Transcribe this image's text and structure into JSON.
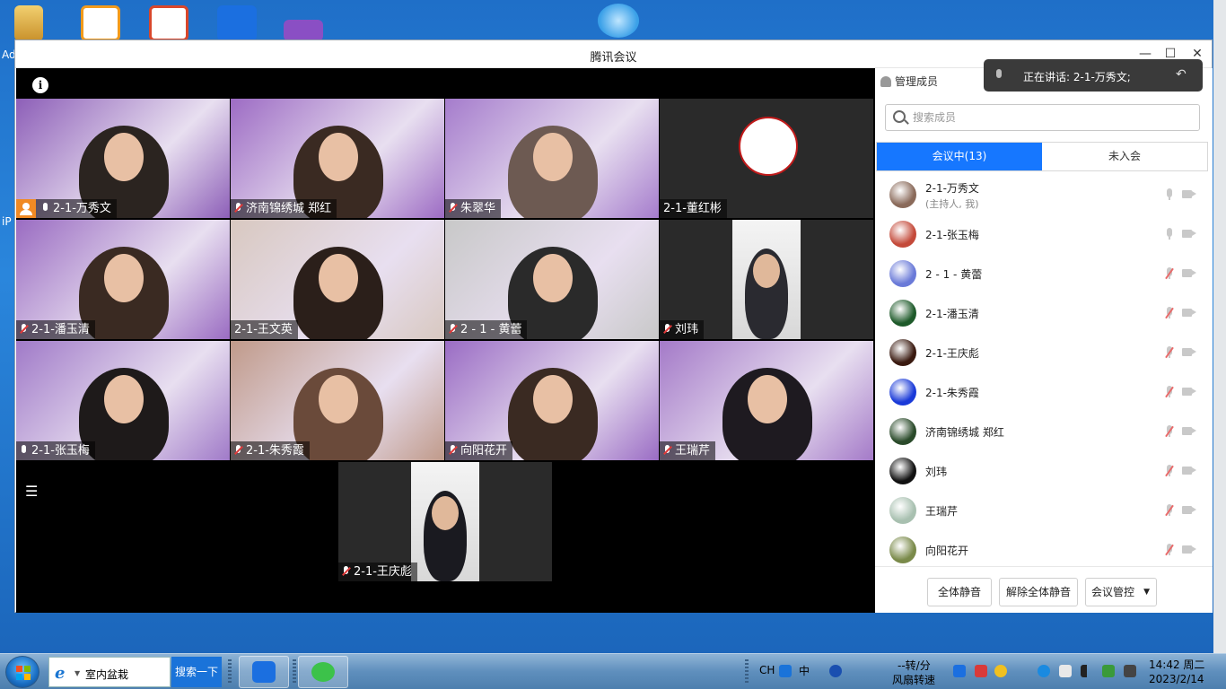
{
  "desktop": {
    "left_texts": [
      "Ad",
      "iP"
    ],
    "icons": [
      {
        "name": "folder-user-icon",
        "color": "#e0b040"
      },
      {
        "name": "wps-presentation-icon",
        "color": "#f29a1b"
      },
      {
        "name": "powerpoint-icon",
        "color": "#d9472b"
      },
      {
        "name": "tencent-meeting-icon",
        "color": "#1b6fe0"
      },
      {
        "name": "purple-file-icon",
        "color": "#7a3fb0"
      }
    ]
  },
  "window": {
    "title": "腾讯会议",
    "minimize": "—",
    "maximize": "☐",
    "close": "✕"
  },
  "video": {
    "tiles": [
      {
        "name": "2-1-万秀文",
        "host": true,
        "muted": false,
        "active": true,
        "bg": "#8d5fb8",
        "person": "#2b2420"
      },
      {
        "name": "济南锦绣城  郑红",
        "host": false,
        "muted": true,
        "bg": "#9d6cc4",
        "person": "#3a2a22"
      },
      {
        "name": "朱翠华",
        "host": false,
        "muted": true,
        "bg": "#a57ccc",
        "person": "#6d5a52"
      },
      {
        "name": "2-1-董红彬",
        "host": false,
        "muted": false,
        "nobar": true,
        "bg": "#2a2a2a",
        "person": "#d8c8b0"
      },
      {
        "name": "2-1-潘玉清",
        "host": false,
        "muted": true,
        "bg": "#9a6cc2",
        "person": "#3a2a22"
      },
      {
        "name": "2-1-王文英",
        "host": false,
        "muted": false,
        "nobar": true,
        "bg": "#d8c8c0",
        "person": "#2b1f1a"
      },
      {
        "name": "2 - 1 - 黄蕾",
        "host": false,
        "muted": true,
        "bg": "#c8c8c8",
        "person": "#2a2a2a"
      },
      {
        "name": "刘玮",
        "host": false,
        "muted": true,
        "bg": "#2a2a2a",
        "person": "#2a2a30"
      },
      {
        "name": "2-1-张玉梅",
        "host": false,
        "muted": false,
        "bg": "#a07ac8",
        "person": "#1e1a1a"
      },
      {
        "name": "2-1-朱秀霞",
        "host": false,
        "muted": true,
        "bg": "#c09a8a",
        "person": "#6a4a3a"
      },
      {
        "name": "向阳花开",
        "host": false,
        "muted": true,
        "bg": "#9a6cc4",
        "person": "#3a2a22"
      },
      {
        "name": "王瑞芹",
        "host": false,
        "muted": true,
        "bg": "#a47ac8",
        "person": "#1e1a20"
      },
      {
        "name": "2-1-王庆彪",
        "host": false,
        "muted": true,
        "bg": "#2a2a2a",
        "person": "#1a1a20"
      }
    ]
  },
  "speaking_banner": {
    "text": "正在讲话: 2-1-万秀文;"
  },
  "panel": {
    "header": "管理成员",
    "search_placeholder": "搜索成员",
    "tabs": [
      {
        "label": "会议中(13)",
        "active": true
      },
      {
        "label": "未入会",
        "active": false
      }
    ],
    "members": [
      {
        "name": "2-1-万秀文",
        "sub": "(主持人, 我)",
        "muted": false,
        "avatar": "#8a6a5a"
      },
      {
        "name": "2-1-张玉梅",
        "sub": "",
        "muted": false,
        "avatar": "#c44a3a"
      },
      {
        "name": "2 - 1 - 黄蕾",
        "sub": "",
        "muted": true,
        "avatar": "#6a7ad8"
      },
      {
        "name": "2-1-潘玉清",
        "sub": "",
        "muted": true,
        "avatar": "#1e5a2a"
      },
      {
        "name": "2-1-王庆彪",
        "sub": "",
        "muted": true,
        "avatar": "#3a1a10"
      },
      {
        "name": "2-1-朱秀霞",
        "sub": "",
        "muted": true,
        "avatar": "#1a3ad8"
      },
      {
        "name": "济南锦绣城  郑红",
        "sub": "",
        "muted": true,
        "avatar": "#2a4a2a"
      },
      {
        "name": "刘玮",
        "sub": "",
        "muted": true,
        "avatar": "#111111"
      },
      {
        "name": "王瑞芹",
        "sub": "",
        "muted": true,
        "avatar": "#a8c0b0"
      },
      {
        "name": "向阳花开",
        "sub": "",
        "muted": true,
        "avatar": "#7a8a4a"
      }
    ],
    "footer": {
      "mute_all": "全体静音",
      "unmute_all": "解除全体静音",
      "control": "会议管控"
    }
  },
  "taskbar": {
    "browser_text": "室内盆栽",
    "search_btn": "搜索一下",
    "ime": [
      "CH",
      "中"
    ],
    "speed_line1": "--转/分",
    "speed_line2": "风扇转速",
    "time": "14:42 周二",
    "date": "2023/2/14"
  },
  "colors": {
    "accent": "#1677ff",
    "host": "#f08a24",
    "active": "#3cc36a",
    "muted": "#e03a3a"
  }
}
